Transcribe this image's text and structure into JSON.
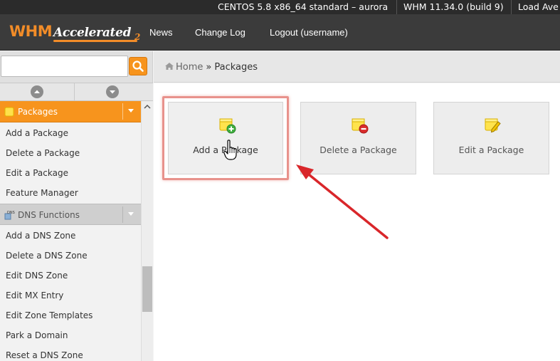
{
  "infobar": {
    "server": "CENTOS 5.8 x86_64 standard – aurora",
    "version": "WHM 11.34.0 (build 9)",
    "load": "Load Ave"
  },
  "header": {
    "logo_whm": "WHM",
    "logo_accelerated": "Accelerated",
    "logo_version": "2",
    "nav": [
      "News",
      "Change Log",
      "Logout (username)"
    ]
  },
  "search": {
    "value": "",
    "placeholder": ""
  },
  "breadcrumb": {
    "home": "Home",
    "separator": "»",
    "current": "Packages"
  },
  "sidebar": {
    "group_packages": "Packages",
    "packages_items": [
      "Add a Package",
      "Delete a Package",
      "Edit a Package",
      "Feature Manager"
    ],
    "group_dns": "DNS Functions",
    "dns_items": [
      "Add a DNS Zone",
      "Delete a DNS Zone",
      "Edit DNS Zone",
      "Edit MX Entry",
      "Edit Zone Templates",
      "Park a Domain",
      "Reset a DNS Zone"
    ]
  },
  "tiles": [
    {
      "label": "Add a Package",
      "icon": "package-add-icon"
    },
    {
      "label": "Delete a Package",
      "icon": "package-delete-icon"
    },
    {
      "label": "Edit a Package",
      "icon": "package-edit-icon"
    }
  ],
  "colors": {
    "accent_orange": "#f7941d",
    "header_bg": "#3b3b3b",
    "highlight": "#e8928c",
    "arrow": "#d9262a"
  }
}
